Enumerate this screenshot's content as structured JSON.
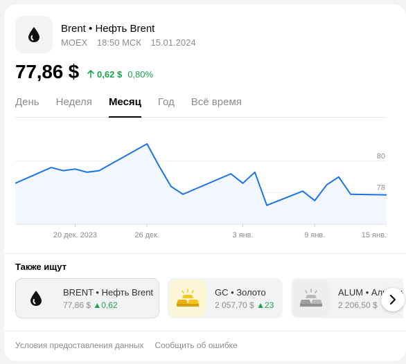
{
  "header": {
    "title": "Brent • Нефть Brent",
    "exchange": "MOEX",
    "time": "18:50 МСК",
    "date": "15.01.2024",
    "logo_icon": "oil-drop-icon"
  },
  "price": {
    "value": "77,86 $",
    "change_abs": "0,62 $",
    "change_pct": "0,80%",
    "up_color": "#1aa34a"
  },
  "tabs": [
    {
      "label": "День"
    },
    {
      "label": "Неделя"
    },
    {
      "label": "Месяц"
    },
    {
      "label": "Год"
    },
    {
      "label": "Всё время"
    }
  ],
  "active_tab": "Месяц",
  "chart_data": {
    "type": "area",
    "x": [
      "2023-12-15",
      "2023-12-18",
      "2023-12-19",
      "2023-12-20",
      "2023-12-21",
      "2023-12-22",
      "2023-12-26",
      "2023-12-27",
      "2023-12-28",
      "2023-12-29",
      "2024-01-02",
      "2024-01-03",
      "2024-01-04",
      "2024-01-05",
      "2024-01-08",
      "2024-01-09",
      "2024-01-10",
      "2024-01-11",
      "2024-01-12",
      "2024-01-15"
    ],
    "values": [
      78.6,
      79.6,
      79.4,
      79.5,
      79.3,
      79.4,
      81.1,
      79.7,
      78.4,
      77.9,
      79.2,
      78.6,
      79.3,
      77.2,
      78.1,
      77.5,
      78.5,
      79.0,
      77.9,
      77.86
    ],
    "xticks": [
      "20 дек. 2023",
      "26 дек.",
      "3 янв.",
      "9 янв.",
      "15 янв."
    ],
    "yticks": [
      "80",
      "78"
    ],
    "ylim": [
      76,
      82.5
    ],
    "line_color": "#1a73e8",
    "fill_color": "#f2f7fd"
  },
  "also": {
    "title": "Также ищут",
    "items": [
      {
        "name": "BRENT • Нефть Brent",
        "price": "77,86 $",
        "change": "0,62",
        "icon": "oil-drop-icon"
      },
      {
        "name": "GC • Золото",
        "price": "2 057,70 $",
        "change": "23",
        "icon": "gold-bars-icon"
      },
      {
        "name": "ALUM • Алюминий",
        "price": "2 206,50 $",
        "change": "",
        "icon": "aluminum-bars-icon"
      }
    ]
  },
  "footer": {
    "terms": "Условия предоставления данных",
    "report": "Сообщить об ошибке"
  }
}
